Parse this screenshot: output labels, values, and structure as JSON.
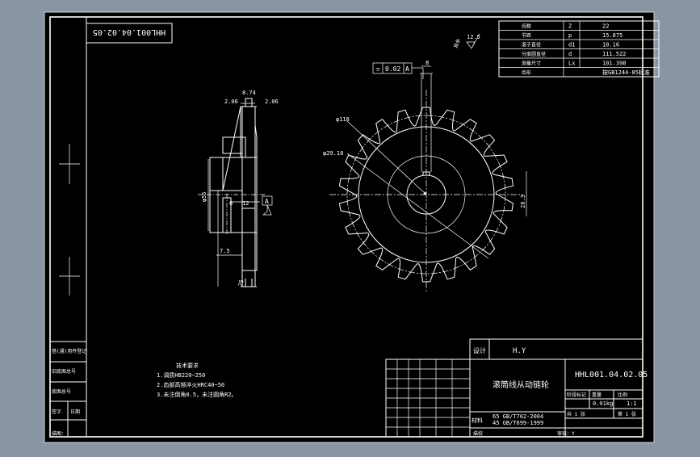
{
  "colors": {
    "paper": "#000000",
    "line": "#ffffff",
    "dim": "#ffffff",
    "frame_bg": "#8a95a3"
  },
  "drawing_number": "HHL001.04.02.05",
  "drawing_number_rotated": "HHL001.04.02.05",
  "roughness_value": "12.5",
  "roughness_note": "其余",
  "tolerance_frame": {
    "symbol": "⌯",
    "value": "0.02",
    "datum": "A"
  },
  "datum_label": "A",
  "param_table": [
    {
      "label": "齿数",
      "symbol": "Z",
      "value": "22"
    },
    {
      "label": "节距",
      "symbol": "p",
      "value": "15.875"
    },
    {
      "label": "滚子直径",
      "symbol": "d1",
      "value": "10.16"
    },
    {
      "label": "分度圆直径",
      "symbol": "d",
      "value": "111.522"
    },
    {
      "label": "测量尺寸",
      "symbol": "Lx",
      "value": "101.398"
    },
    {
      "label": "齿形",
      "symbol": "",
      "value": "按GB1244-85标准"
    }
  ],
  "side_view_dims": {
    "hub_width": "8.74",
    "chamfer_left": "2.06",
    "chamfer_right": "2.06",
    "bore_dia": "φ55",
    "keyway": "6",
    "keyway_depth": "12",
    "shoulder": "7.5",
    "total_width": "25"
  },
  "front_view_dims": {
    "tip_dia": "φ118",
    "root_dia": "φ29.18",
    "key_height": "28.3",
    "key_width": "8"
  },
  "tech_req": {
    "title": "技术要求",
    "items": [
      "1.调质HB220~250",
      "2.齿部高频淬火HRC40~50",
      "3.未注倒角0.5，未注圆角R2。"
    ]
  },
  "left_strip_labels": [
    "借(通)用件登记",
    "旧底图总号",
    "底图总号",
    "签字",
    "日期"
  ],
  "title_block": {
    "designer_label": "设计",
    "designer": "H.Y",
    "part_name": "滚筒线从动链轮",
    "drawing_no": "HHL001.04.02.05",
    "material_label": "材料",
    "material_1": "65 GB/T702-2004",
    "material_2": "45 GB/T699-1999",
    "stage_label": "阶段标记",
    "weight_label": "重量",
    "ratio_label": "比例",
    "weight": "0.91kg",
    "ratio": "1:1",
    "sheet_total": "共 1 张",
    "sheet_no": "第 1 张",
    "bottom_left": "描图：",
    "bottom_mid": "描校",
    "bottom_right": "审核：Y"
  }
}
